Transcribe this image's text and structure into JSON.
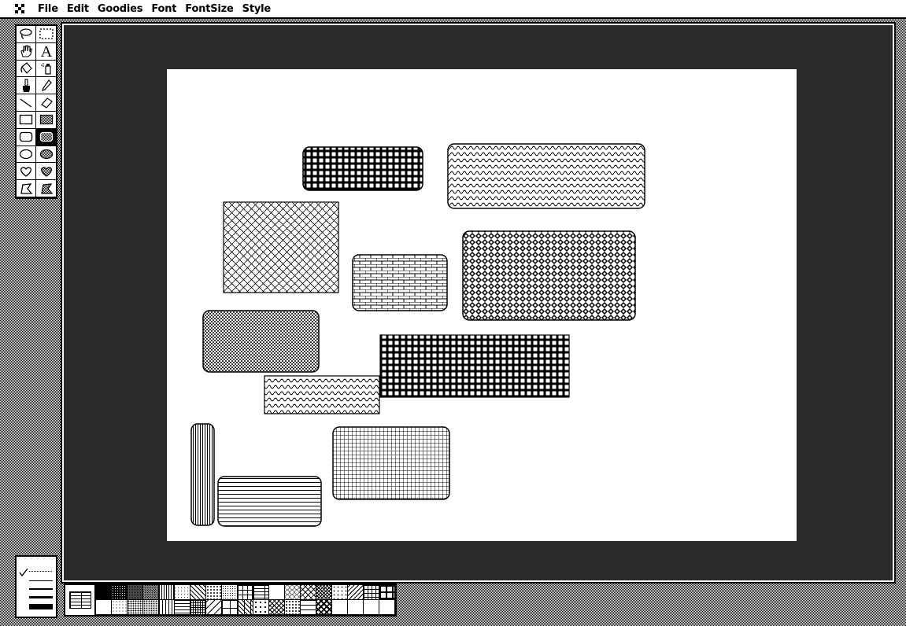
{
  "menubar": {
    "apple_icon": "apple-menu-icon",
    "items": [
      "File",
      "Edit",
      "Goodies",
      "Font",
      "FontSize",
      "Style"
    ]
  },
  "tools": [
    {
      "name": "lasso-tool",
      "icon": "lasso-icon"
    },
    {
      "name": "selection-rectangle-tool",
      "icon": "marquee-icon"
    },
    {
      "name": "grabber-tool",
      "icon": "hand-icon"
    },
    {
      "name": "text-tool",
      "icon": "letter-a-icon",
      "label": "A"
    },
    {
      "name": "paint-bucket-tool",
      "icon": "paint-bucket-icon"
    },
    {
      "name": "spray-can-tool",
      "icon": "spray-can-icon"
    },
    {
      "name": "paintbrush-tool",
      "icon": "paintbrush-icon"
    },
    {
      "name": "pencil-tool",
      "icon": "pencil-icon"
    },
    {
      "name": "line-tool",
      "icon": "line-icon"
    },
    {
      "name": "eraser-tool",
      "icon": "eraser-icon"
    },
    {
      "name": "rectangle-tool",
      "icon": "rectangle-icon"
    },
    {
      "name": "filled-rectangle-tool",
      "icon": "filled-rectangle-icon"
    },
    {
      "name": "rounded-rectangle-tool",
      "icon": "rounded-rectangle-icon"
    },
    {
      "name": "filled-rounded-rectangle-tool",
      "icon": "filled-rounded-rectangle-icon",
      "selected": true
    },
    {
      "name": "oval-tool",
      "icon": "oval-icon"
    },
    {
      "name": "filled-oval-tool",
      "icon": "filled-oval-icon"
    },
    {
      "name": "freeform-tool",
      "icon": "freeform-icon"
    },
    {
      "name": "filled-freeform-tool",
      "icon": "filled-freeform-icon"
    },
    {
      "name": "polygon-tool",
      "icon": "polygon-icon"
    },
    {
      "name": "filled-polygon-tool",
      "icon": "filled-polygon-icon"
    }
  ],
  "line_widths": {
    "selected": "dotted",
    "options": [
      "dotted",
      "thin",
      "medium",
      "thick",
      "extra-thick"
    ]
  },
  "canvas": {
    "background_color": "#2b2b2b",
    "paper_color": "#ffffff",
    "shapes": [
      {
        "pattern": "grid",
        "rounded": true
      },
      {
        "pattern": "wave",
        "rounded": true
      },
      {
        "pattern": "weave",
        "rounded": false
      },
      {
        "pattern": "brick",
        "rounded": true
      },
      {
        "pattern": "diamond",
        "rounded": true
      },
      {
        "pattern": "dots",
        "rounded": true
      },
      {
        "pattern": "grid",
        "rounded": false
      },
      {
        "pattern": "wave",
        "rounded": false
      },
      {
        "pattern": "vertical-lines",
        "rounded": true
      },
      {
        "pattern": "horizontal-lines",
        "rounded": true
      },
      {
        "pattern": "fine-grid",
        "rounded": true
      }
    ]
  },
  "pattern_palette": {
    "current": "brick",
    "count": 38
  }
}
